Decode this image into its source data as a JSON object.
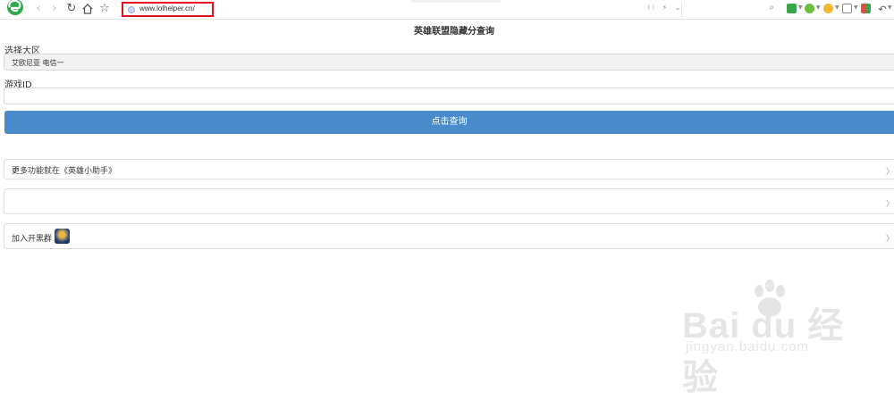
{
  "browser": {
    "url": "www.lolhelper.cn/",
    "url_tools": "⁝⁝ ⚡ ⌄",
    "search_glyph": "⌕",
    "ext_colors": [
      "#3aa64b",
      "#6cbd3e",
      "#f3b630",
      "#e88a2f",
      "#6e6e6e",
      "#3aa64b"
    ]
  },
  "page": {
    "title": "英雄联盟隐藏分查询",
    "region_label": "选择大区",
    "region_value": "艾欧尼亚 电信一",
    "gameid_label": "游戏ID",
    "gameid_value": "",
    "query_button": "点击查询"
  },
  "cards": [
    {
      "label": "更多功能就在《英雄小助手》",
      "chevron": "〉"
    },
    {
      "label": "",
      "chevron": "〉"
    },
    {
      "label": "加入开黑群",
      "chevron": "〉"
    }
  ],
  "watermark": {
    "brand": "Bai du 经验",
    "sub": "jingyan.baidu.com"
  },
  "colors": {
    "accent": "#4a8ccb",
    "url_highlight": "#e3101f"
  }
}
